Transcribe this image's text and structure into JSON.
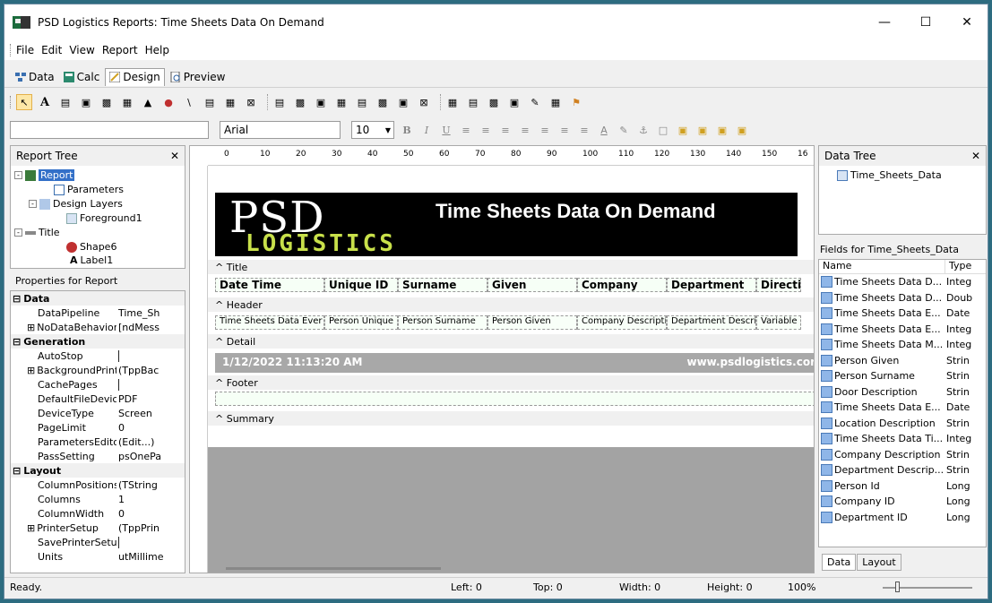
{
  "window": {
    "title": "PSD Logistics Reports: Time Sheets Data On Demand"
  },
  "menu": [
    "File",
    "Edit",
    "View",
    "Report",
    "Help"
  ],
  "tabs": [
    {
      "label": "Data"
    },
    {
      "label": "Calc"
    },
    {
      "label": "Design"
    },
    {
      "label": "Preview"
    }
  ],
  "format_toolbar": {
    "font": "Arial",
    "size": "10"
  },
  "report_tree": {
    "title": "Report Tree",
    "items": [
      "Report",
      "Parameters",
      "Design Layers",
      "Foreground1",
      "Title",
      "Shape6",
      "Label1"
    ]
  },
  "properties": {
    "title": "Properties for Report",
    "rows": [
      {
        "cat": "Data"
      },
      {
        "name": "DataPipeline",
        "value": "Time_Sh"
      },
      {
        "name": "NoDataBehaviors",
        "value": "[ndMess",
        "expandable": true
      },
      {
        "cat": "Generation"
      },
      {
        "name": "AutoStop",
        "check": true
      },
      {
        "name": "BackgroundPrintSe",
        "value": "(TppBac",
        "expandable": true
      },
      {
        "name": "CachePages",
        "check": true
      },
      {
        "name": "DefaultFileDeviceT",
        "value": "PDF"
      },
      {
        "name": "DeviceType",
        "value": "Screen"
      },
      {
        "name": "PageLimit",
        "value": "0"
      },
      {
        "name": "ParametersEditor",
        "value": "(Edit...)"
      },
      {
        "name": "PassSetting",
        "value": "psOnePa"
      },
      {
        "cat": "Layout"
      },
      {
        "name": "ColumnPositions",
        "value": "(TString"
      },
      {
        "name": "Columns",
        "value": "1"
      },
      {
        "name": "ColumnWidth",
        "value": "0"
      },
      {
        "name": "PrinterSetup",
        "value": "(TppPrin",
        "expandable": true
      },
      {
        "name": "SavePrinterSetup",
        "check": true
      },
      {
        "name": "Units",
        "value": "utMillime"
      }
    ]
  },
  "ruler": [
    "0",
    "10",
    "20",
    "30",
    "40",
    "50",
    "60",
    "70",
    "80",
    "90",
    "100",
    "110",
    "120",
    "130",
    "140",
    "150",
    "16"
  ],
  "bands": {
    "title": "Title",
    "header": "Header",
    "detail": "Detail",
    "footer": "Footer",
    "summary": "Summary"
  },
  "logo": {
    "psd": "PSD",
    "logistics": "LOGISTICS"
  },
  "report_title": "Time Sheets Data On Demand",
  "header_labels": [
    "Date Time",
    "Unique ID",
    "Surname",
    "Given",
    "Company",
    "Department",
    "Directi"
  ],
  "detail_fields": [
    "Time Sheets Data Ever",
    "Person Unique",
    "Person Surname",
    "Person Given",
    "Company Descriptio",
    "Department Descrip",
    "Variable"
  ],
  "footer": {
    "date": "1/12/2022 11:13:20 AM",
    "url": "www.psdlogistics.cor"
  },
  "data_tree": {
    "title": "Data Tree",
    "item": "Time_Sheets_Data"
  },
  "fields": {
    "title": "Fields for Time_Sheets_Data",
    "col_name": "Name",
    "col_type": "Type",
    "rows": [
      {
        "name": "Time Sheets Data D...",
        "type": "Integ"
      },
      {
        "name": "Time Sheets Data D...",
        "type": "Doub"
      },
      {
        "name": "Time Sheets Data E...",
        "type": "Date"
      },
      {
        "name": "Time Sheets Data E...",
        "type": "Integ"
      },
      {
        "name": "Time Sheets Data M...",
        "type": "Integ"
      },
      {
        "name": "Person Given",
        "type": "Strin"
      },
      {
        "name": "Person Surname",
        "type": "Strin"
      },
      {
        "name": "Door Description",
        "type": "Strin"
      },
      {
        "name": "Time Sheets Data E...",
        "type": "Date"
      },
      {
        "name": "Location Description",
        "type": "Strin"
      },
      {
        "name": "Time Sheets Data Ti...",
        "type": "Integ"
      },
      {
        "name": "Company Description",
        "type": "Strin"
      },
      {
        "name": "Department Descrip...",
        "type": "Strin"
      },
      {
        "name": "Person Id",
        "type": "Long"
      },
      {
        "name": "Company ID",
        "type": "Long"
      },
      {
        "name": "Department ID",
        "type": "Long"
      }
    ]
  },
  "right_tabs": [
    "Data",
    "Layout"
  ],
  "status": {
    "text": "Ready.",
    "left": "Left: 0",
    "top": "Top: 0",
    "width": "Width: 0",
    "height": "Height: 0",
    "zoom": "100%"
  },
  "colors": {
    "logo_green": "#c8e04a",
    "footer_gray": "#a8a8a8",
    "desktop": "#2d6c80"
  }
}
